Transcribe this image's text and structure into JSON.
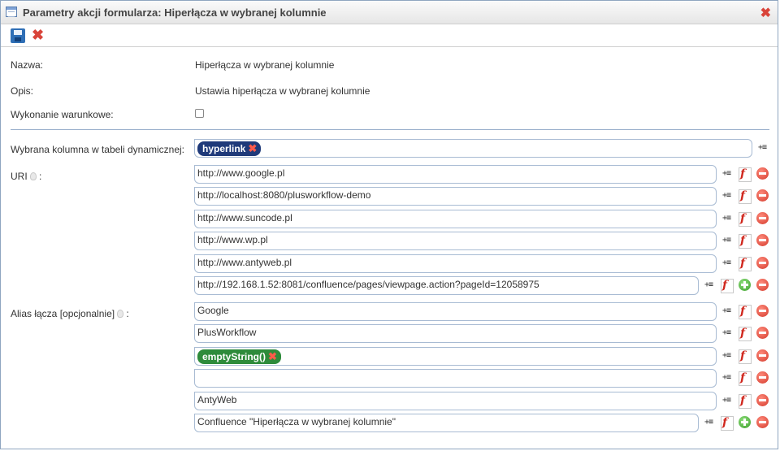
{
  "dialog": {
    "title": "Parametry akcji formularza: Hiperłącza w wybranej kolumnie",
    "close_symbol": "✖"
  },
  "toolbar": {
    "save_icon": "save-icon",
    "close_symbol": "✖"
  },
  "form": {
    "name_label": "Nazwa:",
    "name_value": "Hiperłącza w wybranej kolumnie",
    "desc_label": "Opis:",
    "desc_value": "Ustawia hiperłącza w wybranej kolumnie",
    "conditional_label": "Wykonanie warunkowe:",
    "conditional_checked": false,
    "column_label": "Wybrana kolumna w tabeli dynamicznej:",
    "column_value": "hyperlink",
    "uri_label": "URI",
    "uri_values": [
      "http://www.google.pl",
      "http://localhost:8080/plusworkflow-demo",
      "http://www.suncode.pl",
      "http://www.wp.pl",
      "http://www.antyweb.pl",
      "http://192.168.1.52:8081/confluence/pages/viewpage.action?pageId=12058975"
    ],
    "alias_label": "Alias łącza [opcjonalnie]",
    "alias_values": [
      "Google",
      "PlusWorkflow",
      "emptyString()",
      "",
      "AntyWeb",
      "Confluence \"Hiperłącza w wybranej kolumnie\""
    ],
    "colon": ":"
  },
  "icons": {
    "variable": "variable-insert-icon",
    "function": "function-icon",
    "remove": "remove-icon",
    "add": "add-icon",
    "hint": "lightbulb-icon"
  },
  "colors": {
    "pill_navy": "#1f3a7a",
    "pill_green": "#2e8b3b",
    "remove": "#d43a2c",
    "add": "#3c9d2b"
  }
}
